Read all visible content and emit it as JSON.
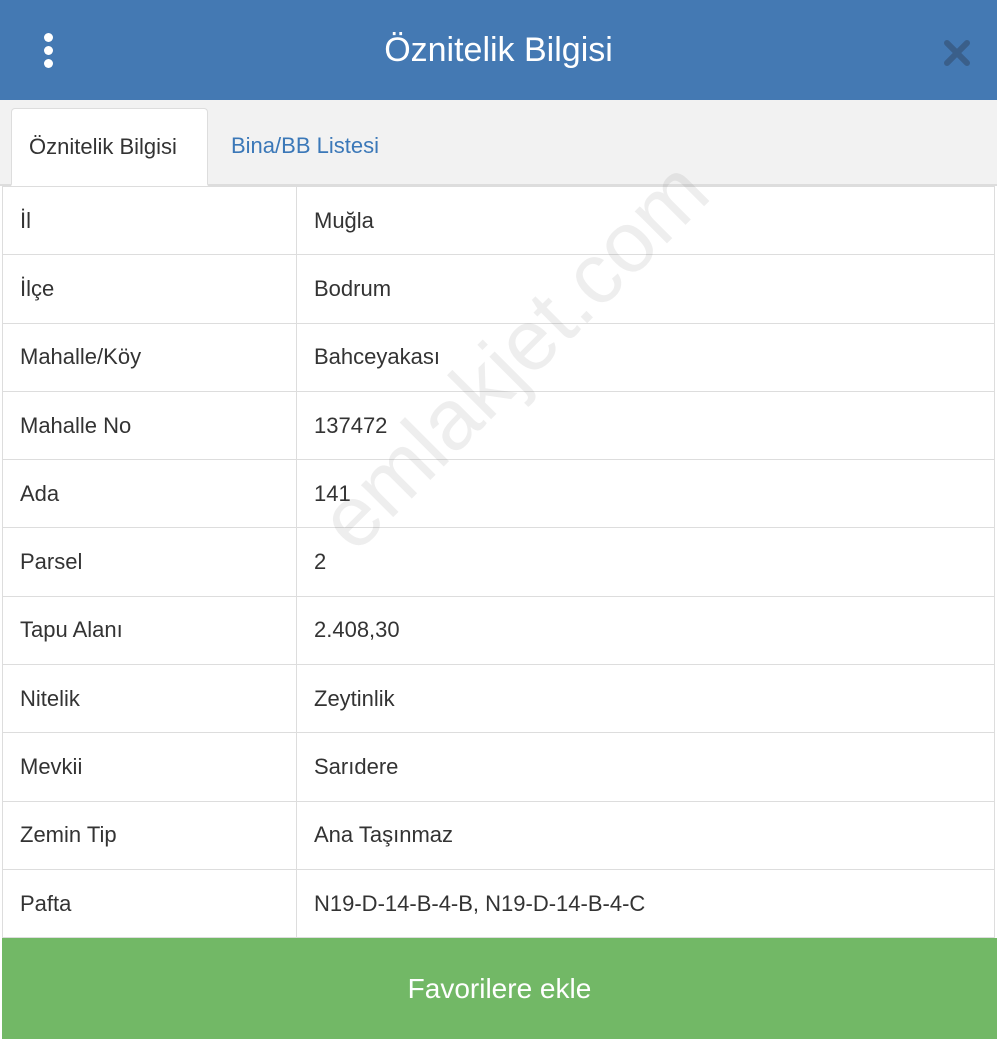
{
  "header": {
    "title": "Öznitelik Bilgisi",
    "menu_icon": "vertical-dots-icon",
    "close_icon": "close-x-icon",
    "color": "#4479b3"
  },
  "tabs": [
    {
      "label": "Öznitelik Bilgisi",
      "active": true
    },
    {
      "label": "Bina/BB Listesi",
      "active": false
    }
  ],
  "attributes": [
    {
      "key": "İl",
      "value": "Muğla"
    },
    {
      "key": "İlçe",
      "value": "Bodrum"
    },
    {
      "key": "Mahalle/Köy",
      "value": "Bahceyakası"
    },
    {
      "key": "Mahalle No",
      "value": "137472"
    },
    {
      "key": "Ada",
      "value": "141"
    },
    {
      "key": "Parsel",
      "value": "2"
    },
    {
      "key": "Tapu Alanı",
      "value": "2.408,30"
    },
    {
      "key": "Nitelik",
      "value": "Zeytinlik"
    },
    {
      "key": "Mevkii",
      "value": "Sarıdere"
    },
    {
      "key": "Zemin Tip",
      "value": "Ana Taşınmaz"
    },
    {
      "key": "Pafta",
      "value": "N19-D-14-B-4-B, N19-D-14-B-4-C"
    }
  ],
  "watermark": "emlakjet.com",
  "footer": {
    "favorite_label": "Favorilere ekle",
    "color": "#72b866"
  }
}
